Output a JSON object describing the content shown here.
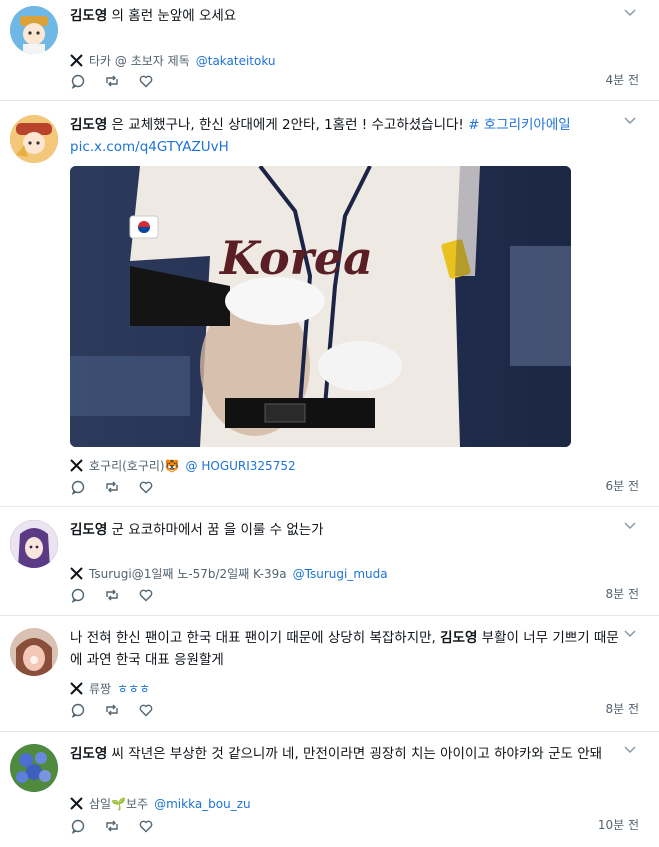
{
  "tweets": [
    {
      "name": "김도영",
      "text": " 의 홈런 눈앞에 오세요",
      "source_name": "타카 @ 초보자 제독",
      "source_handle": "@takateitoku",
      "time": "4분 전",
      "avatar_color": "#6fb8e6"
    },
    {
      "name": "김도영",
      "text": " 은 교체했구나, 한신 상대에게 2안타, 1홈런 ! 수고하셨습니다! ",
      "hashtag": "# 호그리키아에일",
      "link": "pic.x.com/q4GTYAZUvH",
      "media_label": "Korea",
      "source_name": "호구리(호구리)🐯",
      "source_handle": "@ HOGURI325752",
      "time": "6분 전",
      "avatar_color": "#e9a55b"
    },
    {
      "name": "김도영",
      "text": " 군 요코하마에서 꿈 을 이룰 수 없는가",
      "source_name": "Tsurugi@1일째 노-57b/2일째 K-39a",
      "source_handle": "@Tsurugi_muda",
      "time": "8분 전",
      "avatar_color": "#6a3f8f"
    },
    {
      "text_before": "나 전혀 한신 팬이고 한국 대표 팬이기 때문에 상당히 복잡하지만, ",
      "name": "김도영",
      "text_after": " 부활이 너무 기쁘기 때문에 과연 한국 대표 응원할게",
      "source_name": "류짱",
      "source_handle": "ㅎㅎㅎ",
      "time": "8분 전",
      "avatar_color": "#e7b7a4"
    },
    {
      "name": "김도영",
      "text": " 씨 작년은 부상한 것 같으니까 네, 만전이라면 굉장히 치는 아이이고 하야카와 군도 안돼",
      "source_name": "삼일🌱보주",
      "source_handle": "@mikka_bou_zu",
      "time": "10분 전",
      "avatar_color": "#3f6fb0"
    }
  ],
  "icons": [
    "chevron-down-icon",
    "x-logo-icon",
    "reply-icon",
    "retweet-icon",
    "like-icon"
  ],
  "colors": {
    "link": "#1d73d8",
    "muted": "#536471",
    "divider": "#e6e9ec"
  }
}
